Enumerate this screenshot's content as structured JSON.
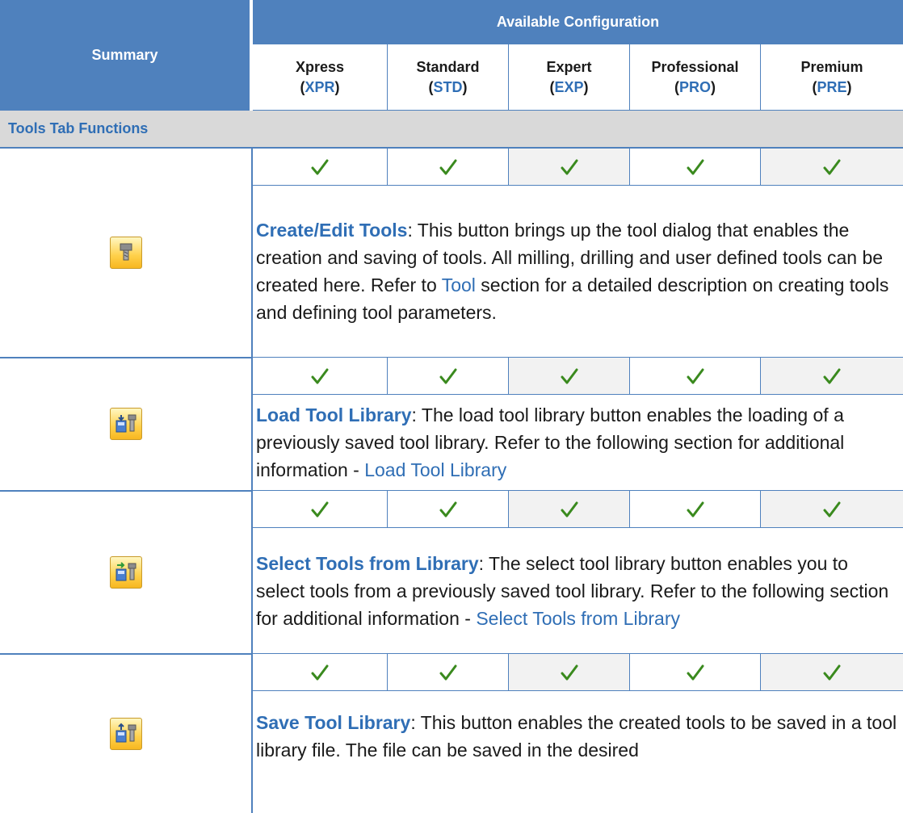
{
  "header": {
    "summary": "Summary",
    "available": "Available Configuration",
    "columns": [
      {
        "name": "Xpress",
        "code": "XPR"
      },
      {
        "name": "Standard",
        "code": "STD"
      },
      {
        "name": "Expert",
        "code": "EXP"
      },
      {
        "name": "Professional",
        "code": "PRO"
      },
      {
        "name": "Premium",
        "code": "PRE"
      }
    ]
  },
  "section": {
    "title": "Tools Tab Functions"
  },
  "rows": [
    {
      "icon": "create-edit-tools-icon",
      "title": "Create/Edit Tools",
      "text": ": This button brings up the tool dialog that enables the creation and saving of tools. All milling, drilling and user defined tools can be created here.  Refer to ",
      "link": "Tool",
      "text_after": " section for a detailed description on creating tools and defining tool parameters."
    },
    {
      "icon": "load-tool-library-icon",
      "title": "Load Tool Library",
      "text": ": The load tool library button enables the loading of a previously saved tool library.  Refer to the following section for additional information - ",
      "link": "Load Tool Library",
      "text_after": ""
    },
    {
      "icon": "select-tools-from-library-icon",
      "title": "Select Tools from Library",
      "text": ": The select tool library button enables you to select tools from a previously saved tool library.  Refer to the following section for additional information - ",
      "link": "Select Tools from Library",
      "text_after": ""
    },
    {
      "icon": "save-tool-library-icon",
      "title": "Save Tool Library",
      "text": ": This button enables the created tools to be saved in a tool library file. The file can be saved in the desired",
      "link": "",
      "text_after": ""
    }
  ],
  "check_icon": "checkmark-icon",
  "colors": {
    "header_bg": "#4f81bd",
    "section_bg": "#d9d9d9",
    "accent": "#2f6eb5",
    "check": "#3a8a1e"
  }
}
